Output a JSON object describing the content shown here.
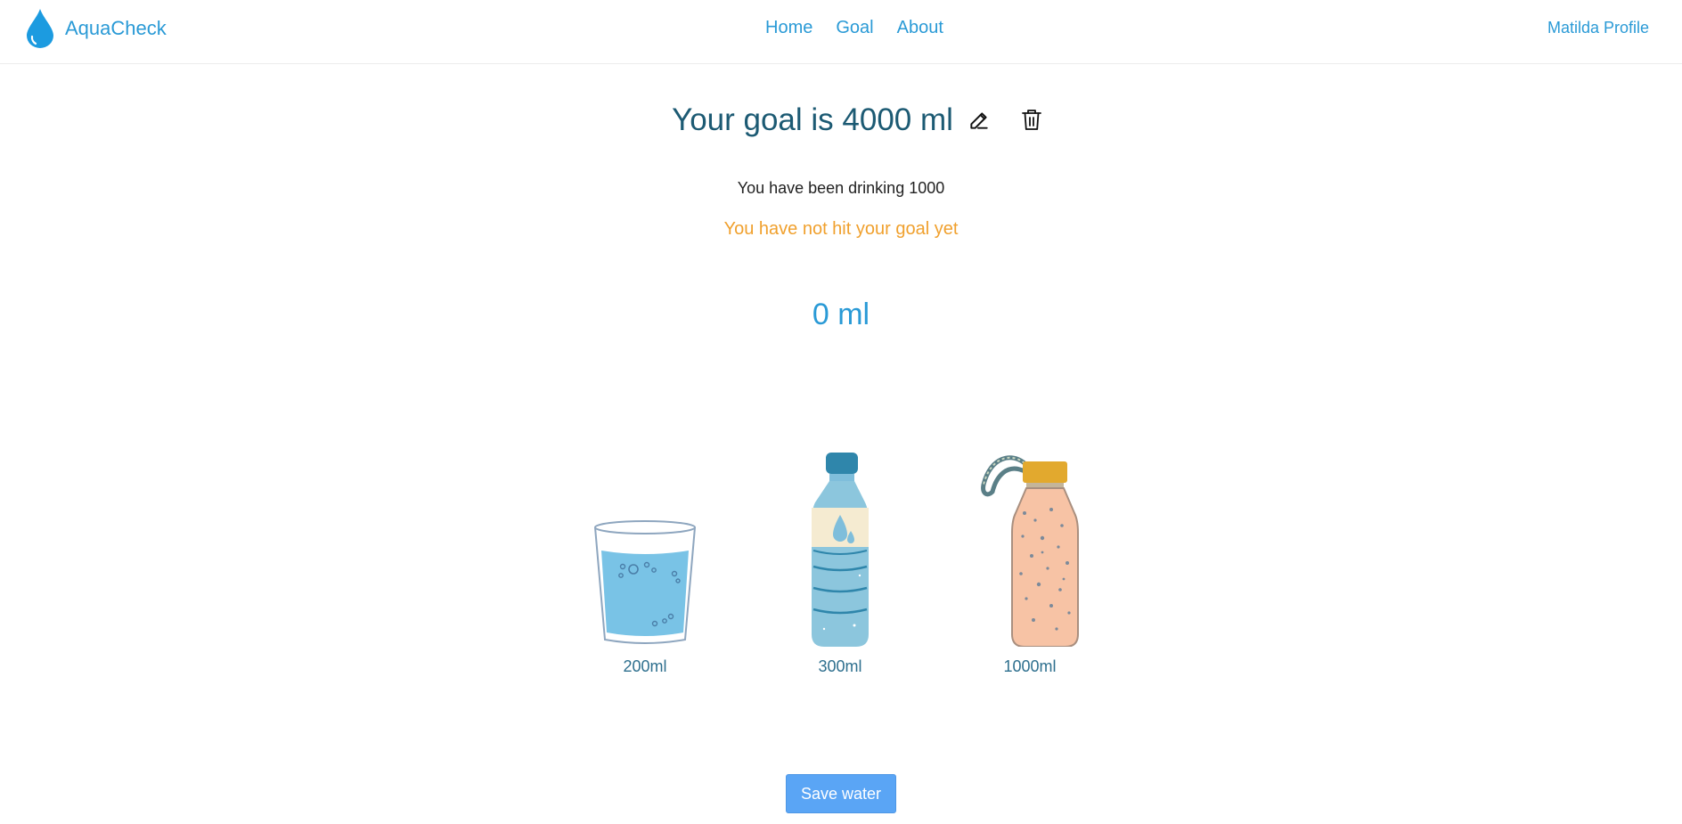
{
  "brand": {
    "name": "AquaCheck",
    "color": "#2a9ad6"
  },
  "nav": {
    "items": [
      {
        "label": "Home"
      },
      {
        "label": "Goal"
      },
      {
        "label": "About"
      }
    ],
    "profile": "Matilda Profile"
  },
  "goal": {
    "title": "Your goal is 4000 ml",
    "drinking": "You have been drinking 1000",
    "status": "You have not hit your goal yet",
    "current_amount": "0 ml"
  },
  "drinks": [
    {
      "label": "200ml",
      "icon": "glass-icon"
    },
    {
      "label": "300ml",
      "icon": "plastic-bottle-icon"
    },
    {
      "label": "1000ml",
      "icon": "flask-bottle-icon"
    }
  ],
  "save_button": "Save water",
  "colors": {
    "accent": "#2a9ad6",
    "title": "#1c5a73",
    "warning": "#f0a02d",
    "button": "#5aa5f5"
  }
}
